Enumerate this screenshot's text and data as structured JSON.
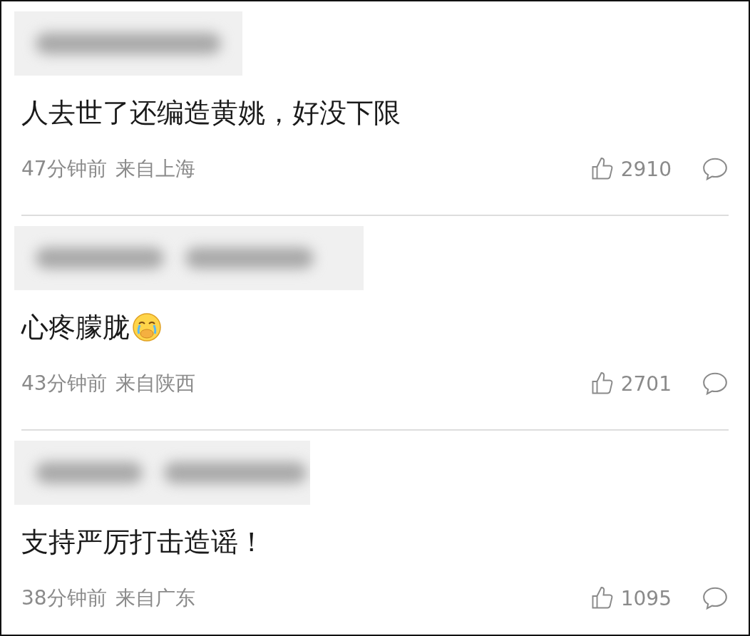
{
  "comments": [
    {
      "text": "人去世了还编造黄姚，好没下限",
      "emoji": false,
      "time": "47分钟前",
      "location": "来自上海",
      "likes": "2910"
    },
    {
      "text": "心疼朦胧",
      "emoji": true,
      "time": "43分钟前",
      "location": "来自陕西",
      "likes": "2701"
    },
    {
      "text": "支持严厉打击造谣！",
      "emoji": false,
      "time": "38分钟前",
      "location": "来自广东",
      "likes": "1095"
    }
  ]
}
